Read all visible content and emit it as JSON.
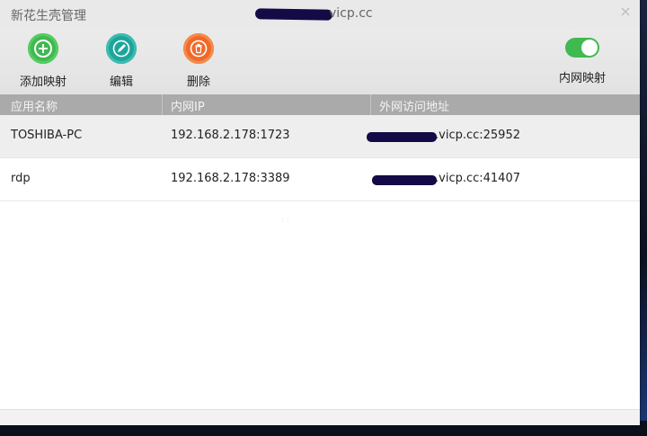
{
  "window": {
    "title": "新花生壳管理",
    "title_domain": "vicp.cc",
    "close_glyph": "×"
  },
  "toolbar": {
    "add_label": "添加映射",
    "edit_label": "编辑",
    "delete_label": "删除",
    "toggle_label": "内网映射",
    "toggle_on": true,
    "accent_add": "#3fb950",
    "accent_edit": "#1ea59a",
    "accent_delete": "#ef6a2a"
  },
  "table": {
    "columns": [
      "应用名称",
      "内网IP",
      "外网访问地址"
    ],
    "rows": [
      {
        "name": "TOSHIBA-PC",
        "ip": "192.168.2.178:1723",
        "external": ".vicp.cc:25952"
      },
      {
        "name": "rdp",
        "ip": "192.168.2.178:3389",
        "external": ".vicp.cc:41407"
      }
    ]
  },
  "icons": [
    "plus-icon",
    "pencil-icon",
    "trash-icon",
    "close-icon"
  ]
}
